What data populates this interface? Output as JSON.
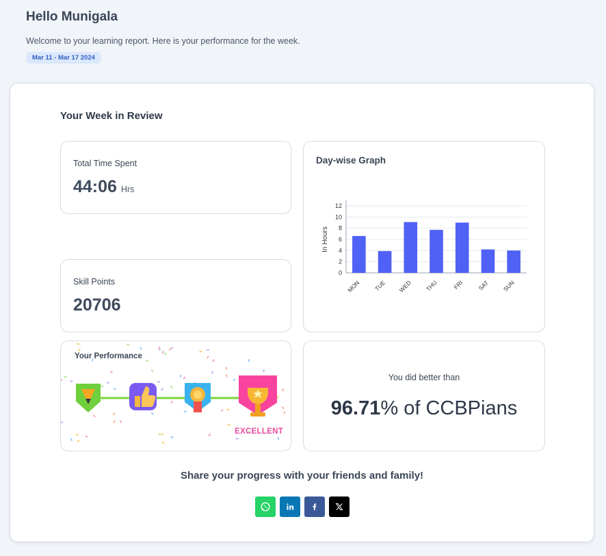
{
  "header": {
    "greeting": "Hello Munigala",
    "welcome": "Welcome to your learning report. Here is your performance for the week.",
    "date_range": "Mar 11 - Mar 17 2024"
  },
  "review": {
    "title": "Your Week in Review",
    "time": {
      "label": "Total Time Spent",
      "value": "44:06",
      "unit": "Hrs"
    },
    "skill": {
      "label": "Skill Points",
      "value": "20706"
    },
    "graph": {
      "title": "Day-wise Graph"
    },
    "performance": {
      "title": "Your Performance",
      "level": "EXCELLENT"
    },
    "better": {
      "label": "You did better than",
      "percent": "96.71",
      "suffix": "% of CCBPians"
    }
  },
  "share": {
    "text": "Share your progress with your friends and family!",
    "buttons": [
      {
        "name": "whatsapp",
        "color": "#25d366"
      },
      {
        "name": "linkedin",
        "color": "#0a77b5"
      },
      {
        "name": "facebook",
        "color": "#3b5998"
      },
      {
        "name": "x",
        "color": "#000000"
      }
    ]
  },
  "chart_data": {
    "type": "bar",
    "categories": [
      "MON",
      "TUE",
      "WED",
      "THU",
      "FRI",
      "SAT",
      "SUN"
    ],
    "values": [
      6.6,
      3.9,
      9.1,
      7.7,
      9.0,
      4.2,
      4.0
    ],
    "ylabel": "In Hours",
    "ylim": [
      0,
      12
    ],
    "yticks": [
      0,
      2,
      4,
      6,
      8,
      10,
      12
    ],
    "grid": true,
    "color": "#5061f5"
  }
}
